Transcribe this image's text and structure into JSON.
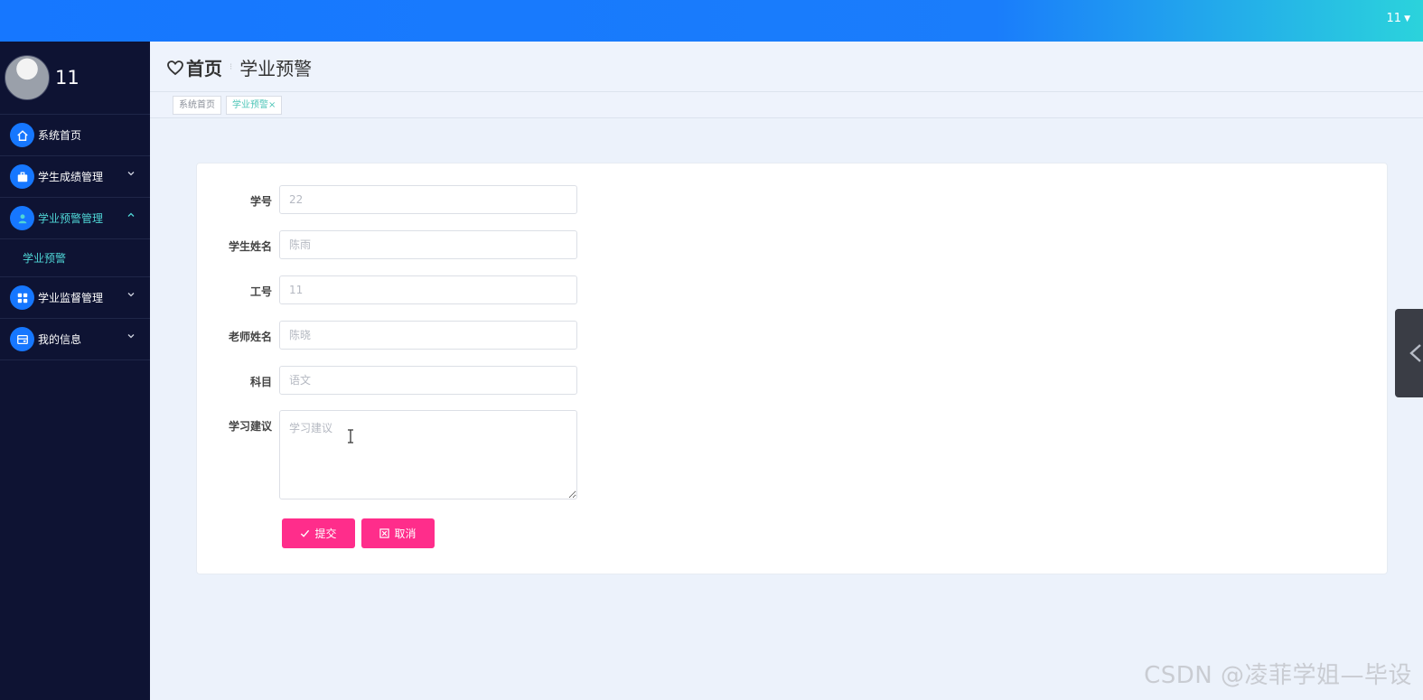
{
  "topbar": {
    "username": "11"
  },
  "sidebar": {
    "profile_name": "11",
    "items": [
      {
        "label": "系统首页",
        "icon": "home-icon"
      },
      {
        "label": "学生成绩管理",
        "icon": "briefcase-icon"
      },
      {
        "label": "学业预警管理",
        "icon": "user-icon",
        "active": true,
        "sub": [
          "学业预警"
        ]
      },
      {
        "label": "学业监督管理",
        "icon": "grid-icon"
      },
      {
        "label": "我的信息",
        "icon": "card-icon"
      }
    ]
  },
  "breadcrumb": {
    "home": "首页",
    "current": "学业预警"
  },
  "tags": [
    {
      "label": "系统首页"
    },
    {
      "label": "学业预警",
      "close": "×"
    }
  ],
  "form": {
    "fields": [
      {
        "label": "学号",
        "value": "22"
      },
      {
        "label": "学生姓名",
        "value": "陈雨"
      },
      {
        "label": "工号",
        "value": "11"
      },
      {
        "label": "老师姓名",
        "value": "陈晓"
      },
      {
        "label": "科目",
        "value": "语文"
      }
    ],
    "advice": {
      "label": "学习建议",
      "placeholder": "学习建议"
    },
    "submit_label": "提交",
    "cancel_label": "取消"
  },
  "watermark": "CSDN @凌菲学姐—毕设",
  "colors": {
    "topbar_start": "#1677ff",
    "topbar_end": "#2bd3dc",
    "sidebar_bg": "#0e1333",
    "accent": "#4fd6d6",
    "button": "#ff2d8b"
  }
}
